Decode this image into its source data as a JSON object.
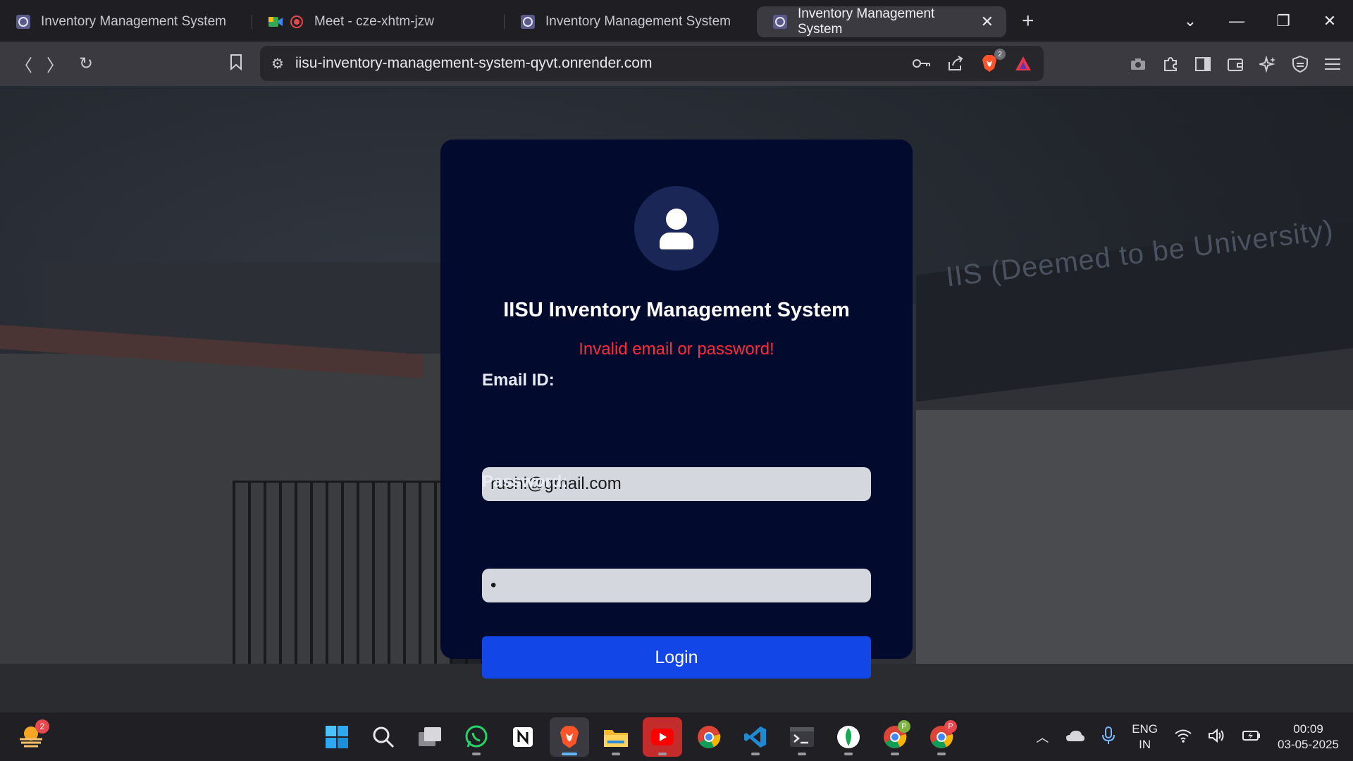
{
  "tabs": [
    {
      "title": "Inventory Management System",
      "active": false
    },
    {
      "title": "Meet - cze-xhtm-jzw",
      "active": false
    },
    {
      "title": "Inventory Management System",
      "active": false
    },
    {
      "title": "Inventory Management System",
      "active": true
    }
  ],
  "toolbar": {
    "url": "iisu-inventory-management-system-qyvt.onrender.com",
    "brave_shield_count": "2"
  },
  "background": {
    "banner_text": "IIS (Deemed to be University)"
  },
  "login": {
    "title": "IISU Inventory Management System",
    "error": "Invalid email or password!",
    "email_label": "Email ID:",
    "email_value": "ruchi@gmail.com",
    "password_label": "Password:",
    "password_value": "x",
    "button": "Login"
  },
  "taskbar": {
    "weather_badge": "2",
    "chrome_profile_1": "P",
    "chrome_profile_2": "P",
    "lang_line1": "ENG",
    "lang_line2": "IN",
    "time": "00:09",
    "date": "03-05-2025"
  },
  "colors": {
    "card_bg": "#020b2e",
    "button_bg": "#1346e6",
    "error_text": "#ff2a3a",
    "field_bg": "#d4d7dd"
  }
}
